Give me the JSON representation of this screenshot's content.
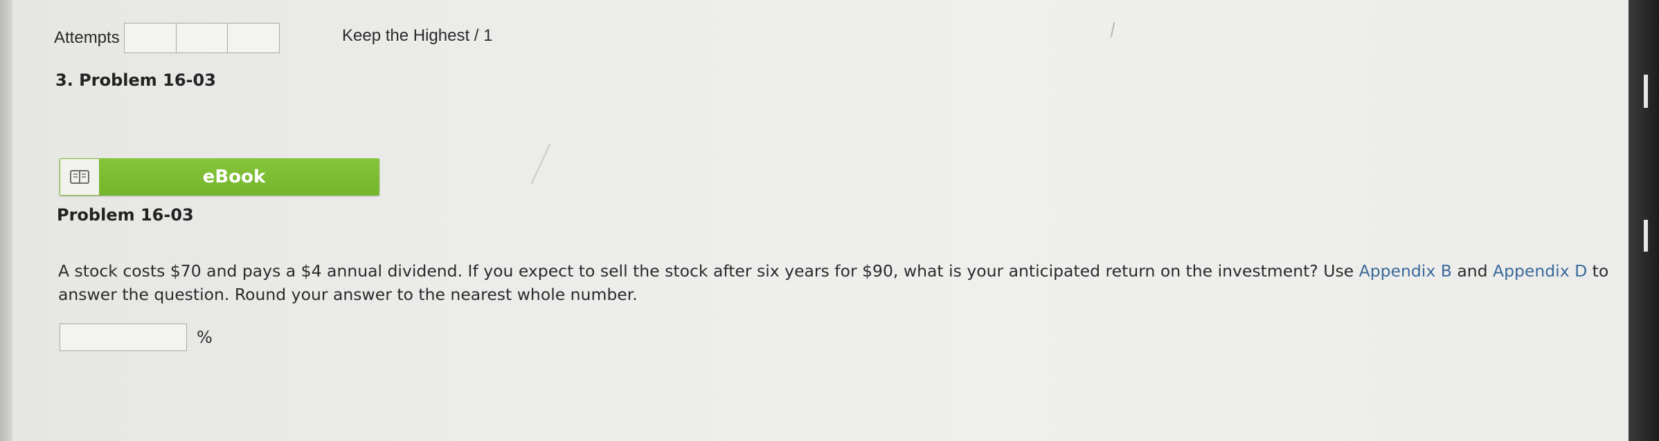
{
  "attempts": {
    "label": "Attempts",
    "box_count": 3,
    "keep_highest": "Keep the Highest / 1"
  },
  "problem": {
    "heading": "3. Problem 16-03",
    "ebook_label": "eBook",
    "subtitle": "Problem 16-03",
    "question_part1": "A stock costs $70 and pays a $4 annual dividend. If you expect to sell the stock after six years for $90, what is your anticipated return on the investment? Use ",
    "link_appendix_b": "Appendix B",
    "and_word": " and ",
    "link_appendix_d": "Appendix D",
    "question_part2": " to answer the question. Round your answer to the nearest whole number.",
    "answer_value": "",
    "answer_unit": "%"
  },
  "icons": {
    "ebook_icon": "open-book-icon"
  },
  "colors": {
    "ebook_green": "#7dbb2e",
    "link_blue": "#3a6a9a"
  }
}
